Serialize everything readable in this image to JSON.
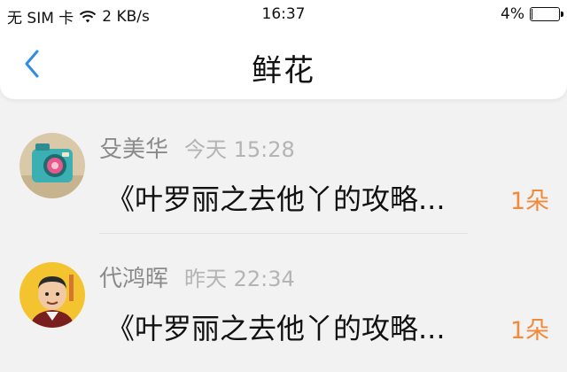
{
  "status_bar": {
    "carrier": "无 SIM 卡",
    "network_speed": "2 KB/s",
    "time": "16:37",
    "battery_percent": "4%",
    "battery_level": 0.04
  },
  "nav": {
    "title": "鲜花"
  },
  "messages": [
    {
      "sender": "殳美华",
      "time": "今天 15:28",
      "text": "《叶罗丽之去他丫的攻略...",
      "count": "1朵"
    },
    {
      "sender": "代鸿晖",
      "time": "昨天 22:34",
      "text": "《叶罗丽之去他丫的攻略...",
      "count": "1朵"
    }
  ],
  "colors": {
    "accent": "#2f8de4",
    "count": "#f08a3c"
  }
}
